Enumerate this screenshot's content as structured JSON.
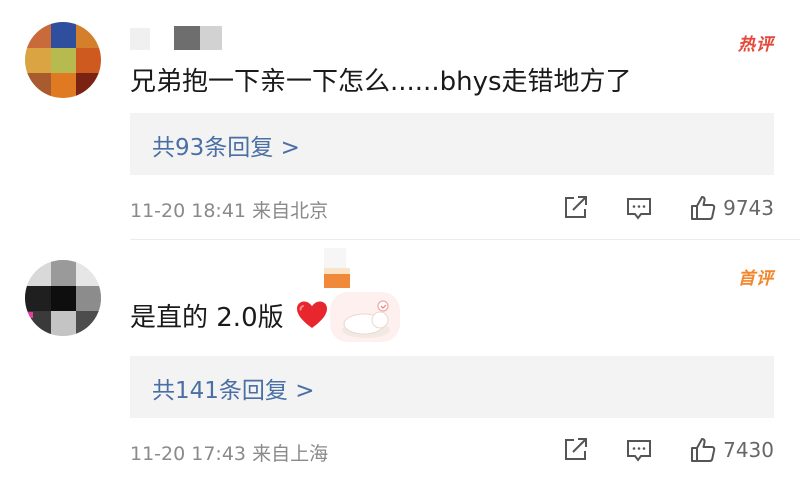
{
  "comments": [
    {
      "badge": "热评",
      "text": "兄弟抱一下亲一下怎么......bhys走错地方了",
      "replies_label": "共93条回复 >",
      "time": "11-20 18:41",
      "source": "来自北京",
      "likes": "9743"
    },
    {
      "badge": "首评",
      "text": "是直的 2.0版",
      "emoji": "heart-emoji",
      "replies_label": "共141条回复 >",
      "time": "11-20 17:43",
      "source": "来自上海",
      "likes": "7430"
    }
  ],
  "colors": {
    "hot_badge": "#e5473b",
    "first_badge": "#f2862b",
    "reply_link": "#4a6fa5",
    "meta_text": "#8a8a8a",
    "reply_bg": "#f3f3f3"
  },
  "icons": [
    "share-icon",
    "comment-icon",
    "like-icon",
    "heart-emoji",
    "sticker-cat"
  ]
}
